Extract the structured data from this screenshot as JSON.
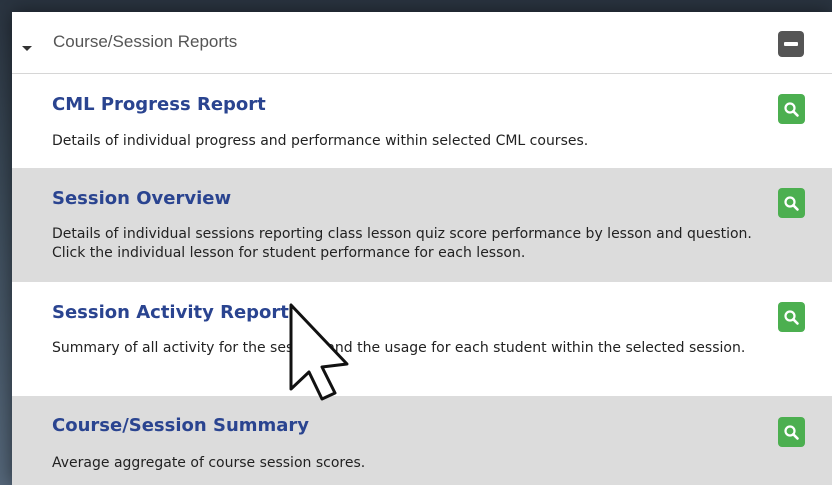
{
  "section": {
    "title": "Course/Session Reports",
    "expand_icon": "caret-down-icon",
    "collapse_icon": "minus-icon"
  },
  "reports": [
    {
      "title": "CML Progress Report",
      "description": "Details of individual progress and performance within selected CML courses.",
      "action_icon": "search-icon"
    },
    {
      "title": "Session Overview",
      "description": "Details of individual sessions reporting class lesson quiz score performance by lesson and question. Click the individual lesson for student performance for each lesson.",
      "action_icon": "search-icon"
    },
    {
      "title": "Session Activity Report",
      "description": "Summary of all activity for the session and the usage for each student within the selected session.",
      "action_icon": "search-icon"
    },
    {
      "title": "Course/Session Summary",
      "description": "Average aggregate of course session scores.",
      "action_icon": "search-icon"
    }
  ],
  "colors": {
    "title_blue": "#2a4490",
    "stripe_gray": "#dcdcdc",
    "action_green": "#4caf50",
    "collapse_gray": "#555555"
  }
}
